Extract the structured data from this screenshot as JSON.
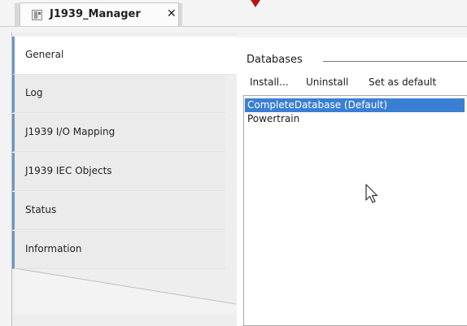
{
  "editor_tab": {
    "title": "J1939_Manager",
    "close_symbol": "✕",
    "icon": "device-icon"
  },
  "nav": {
    "items": [
      {
        "label": "General",
        "active": true
      },
      {
        "label": "Log",
        "active": false
      },
      {
        "label": "J1939 I/O Mapping",
        "active": false
      },
      {
        "label": "J1939 IEC Objects",
        "active": false
      },
      {
        "label": "Status",
        "active": false
      },
      {
        "label": "Information",
        "active": false
      }
    ]
  },
  "databases": {
    "title": "Databases",
    "toolbar": {
      "install": "Install...",
      "uninstall": "Uninstall",
      "set_default": "Set as default"
    },
    "rows": [
      {
        "label": "CompleteDatabase (Default)",
        "selected": true
      },
      {
        "label": "Powertrain",
        "selected": false
      }
    ]
  },
  "colors": {
    "selection": "#3a7fd4",
    "nav_accent": "#6b97c9",
    "tab_marker": "#b01818"
  }
}
